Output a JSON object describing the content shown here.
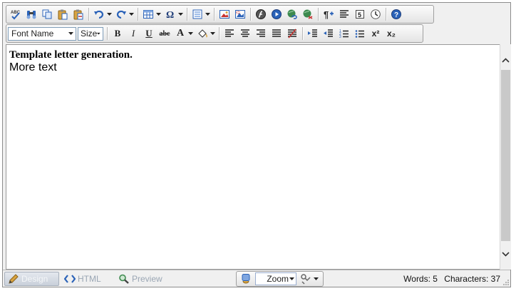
{
  "toolbar": {
    "font_name_label": "Font Name",
    "size_label": "Size",
    "bold_label": "B",
    "italic_label": "I",
    "underline_label": "U",
    "strikethrough_label": "abc",
    "font_color_label": "A",
    "superscript_label": "x²",
    "subscript_label": "x₂"
  },
  "content": {
    "line1": "Template letter generation.",
    "line2": "More text"
  },
  "statusbar": {
    "design_label": "Design",
    "html_label": "HTML",
    "preview_label": "Preview",
    "zoom_label": "Zoom",
    "words_label": "Words: 5",
    "characters_label": "Characters: 37"
  },
  "icons": {
    "spellcheck": "spellcheck-icon",
    "find": "find-icon",
    "copy": "copy-icon",
    "paste": "paste-icon",
    "paste_special": "paste-special-icon",
    "undo": "undo-icon",
    "redo": "redo-icon",
    "table": "table-icon",
    "special_char": "omega-icon",
    "list_style": "list-style-icon",
    "image": "image-icon",
    "image_map": "image-map-icon",
    "flash": "flash-icon",
    "media": "media-icon",
    "hyperlink": "hyperlink-icon",
    "remove_link": "unlink-icon",
    "paragraph": "paragraph-icon",
    "align_paragraph": "paragraph-align-icon",
    "form_element": "form-element-icon",
    "time": "clock-icon",
    "help": "help-icon"
  },
  "colors": {
    "accent_blue": "#2a62b8",
    "toolbar_bg": "#ebebeb",
    "scrollbar_thumb": "#c9c9c9"
  }
}
